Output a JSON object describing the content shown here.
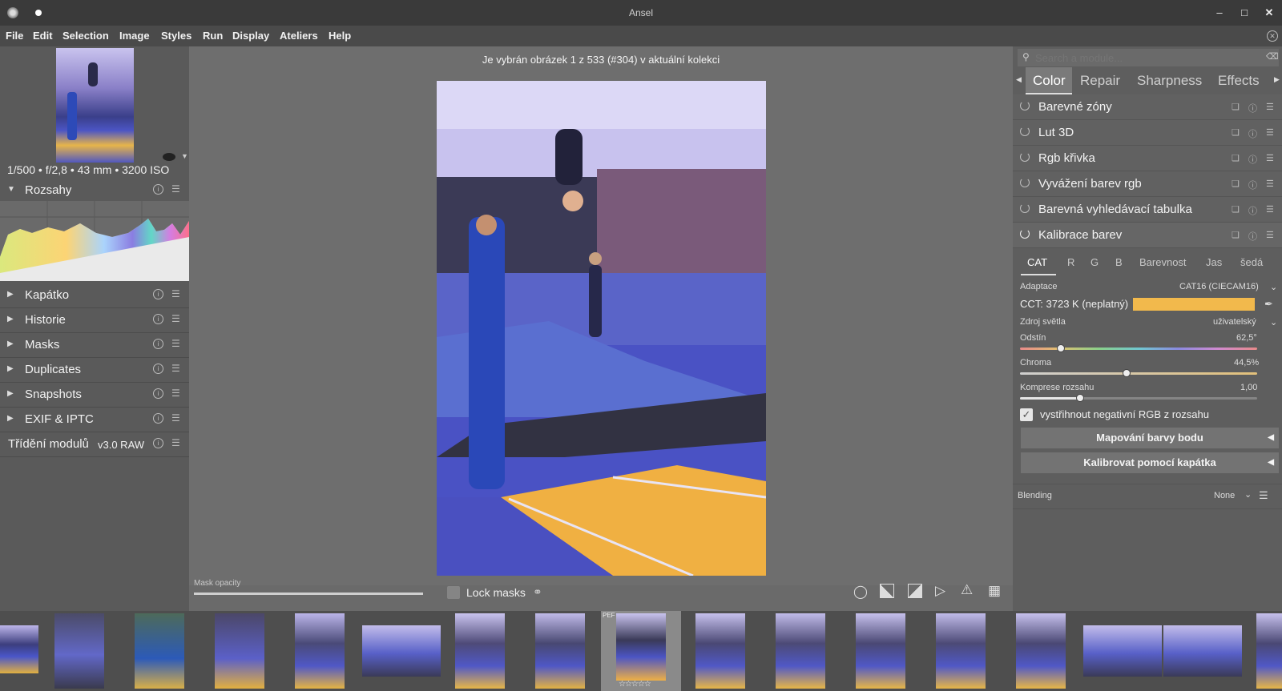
{
  "window": {
    "title": "Ansel"
  },
  "menu": [
    "File",
    "Edit",
    "Selection",
    "Image",
    "Styles",
    "Run",
    "Display",
    "Ateliers",
    "Help"
  ],
  "left_panel": {
    "exif": "1/500 • f/2,8 • 43 mm • 3200 ISO",
    "histogram_label": "Rozsahy",
    "modules": [
      "Kapátko",
      "Historie",
      "Masks",
      "Duplicates",
      "Snapshots",
      "EXIF & IPTC"
    ],
    "module_order_label": "Třídění modulů",
    "module_order_value": "v3.0 RAW"
  },
  "center": {
    "status": "Je vybrán obrázek 1 z 533 (#304) v aktuální kolekci"
  },
  "bottom_bar": {
    "mask_opacity_label": "Mask opacity",
    "lock_masks_label": "Lock masks"
  },
  "right_panel": {
    "search_placeholder": "Search a module...",
    "tabs": [
      "Color",
      "Repair",
      "Sharpness",
      "Effects"
    ],
    "active_tab": "Color",
    "modules": [
      "Barevné zóny",
      "Lut 3D",
      "Rgb křivka",
      "Vyvážení barev rgb",
      "Barevná vyhledávací tabulka",
      "Kalibrace barev"
    ],
    "subtabs": [
      "CAT",
      "R",
      "G",
      "B",
      "Barevnost",
      "Jas",
      "šedá"
    ],
    "adaptace_label": "Adaptace",
    "adaptace_value": "CAT16 (CIECAM16)",
    "cct_label": "CCT: 3723 K (neplatný)",
    "cct_color": "#f2b94c",
    "zdroj_label": "Zdroj světla",
    "zdroj_value": "uživatelský",
    "odstin_label": "Odstín",
    "odstin_value": "62,5°",
    "odstin_fraction": 0.17,
    "chroma_label": "Chroma",
    "chroma_value": "44,5%",
    "chroma_fraction": 0.445,
    "komprese_label": "Komprese rozsahu",
    "komprese_value": "1,00",
    "komprese_fraction": 0.25,
    "checkbox_label": "vystřihnout negativní RGB z rozsahu",
    "btn_map": "Mapování barvy bodu",
    "btn_cal": "Kalibrovat pomocí kapátka",
    "blending_label": "Blending",
    "blending_value": "None"
  },
  "filmstrip": {
    "selected_badge": "PEF",
    "rating": "☆☆☆☆☆"
  }
}
